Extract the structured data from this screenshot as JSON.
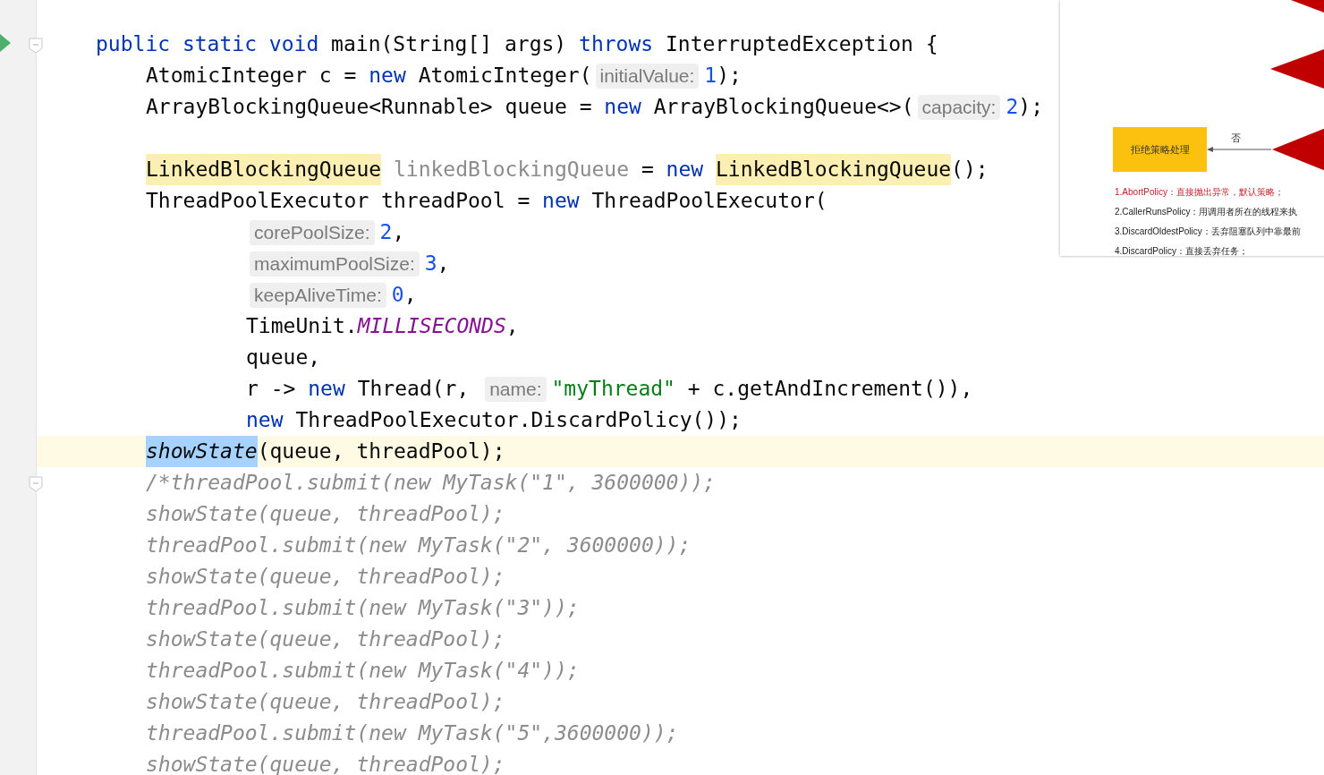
{
  "editor": {
    "lines": [
      {
        "kind": "signature",
        "current": false,
        "tokens": [
          {
            "kind": "kw",
            "text": "public static void "
          },
          {
            "kind": "id",
            "text": "main(String[] args) "
          },
          {
            "kind": "kw",
            "text": "throws "
          },
          {
            "kind": "id",
            "text": "InterruptedException {"
          }
        ]
      },
      {
        "kind": "body",
        "current": false,
        "tokens": [
          {
            "kind": "id",
            "text": "AtomicInteger c = "
          },
          {
            "kind": "kw",
            "text": "new "
          },
          {
            "kind": "id",
            "text": "AtomicInteger("
          },
          {
            "kind": "hint",
            "text": "initialValue:"
          },
          {
            "kind": "num",
            "text": "1"
          },
          {
            "kind": "id",
            "text": ");"
          }
        ]
      },
      {
        "kind": "body",
        "current": false,
        "tokens": [
          {
            "kind": "id",
            "text": "ArrayBlockingQueue<Runnable> queue = "
          },
          {
            "kind": "kw",
            "text": "new "
          },
          {
            "kind": "id",
            "text": "ArrayBlockingQueue<>("
          },
          {
            "kind": "hint",
            "text": "capacity:"
          },
          {
            "kind": "num",
            "text": "2"
          },
          {
            "kind": "id",
            "text": ");"
          }
        ]
      },
      {
        "kind": "blank",
        "current": false
      },
      {
        "kind": "body",
        "current": false,
        "tokens": [
          {
            "kind": "usage",
            "text": "LinkedBlockingQueue"
          },
          {
            "kind": "unused",
            "text": " linkedBlockingQueue"
          },
          {
            "kind": "id",
            "text": " = "
          },
          {
            "kind": "kw",
            "text": "new "
          },
          {
            "kind": "usage",
            "text": "LinkedBlockingQueue"
          },
          {
            "kind": "id",
            "text": "();"
          }
        ]
      },
      {
        "kind": "body",
        "current": false,
        "tokens": [
          {
            "kind": "id",
            "text": "ThreadPoolExecutor threadPool = "
          },
          {
            "kind": "kw",
            "text": "new "
          },
          {
            "kind": "id",
            "text": "ThreadPoolExecutor("
          }
        ]
      },
      {
        "kind": "continuation",
        "current": false,
        "tokens": [
          {
            "kind": "hint",
            "text": "corePoolSize:"
          },
          {
            "kind": "num",
            "text": "2"
          },
          {
            "kind": "id",
            "text": ","
          }
        ]
      },
      {
        "kind": "continuation",
        "current": false,
        "tokens": [
          {
            "kind": "hint",
            "text": "maximumPoolSize:"
          },
          {
            "kind": "num",
            "text": "3"
          },
          {
            "kind": "id",
            "text": ","
          }
        ]
      },
      {
        "kind": "continuation",
        "current": false,
        "tokens": [
          {
            "kind": "hint",
            "text": "keepAliveTime:"
          },
          {
            "kind": "num",
            "text": "0"
          },
          {
            "kind": "id",
            "text": ","
          }
        ]
      },
      {
        "kind": "continuation",
        "current": false,
        "tokens": [
          {
            "kind": "id",
            "text": "TimeUnit."
          },
          {
            "kind": "const",
            "text": "MILLISECONDS"
          },
          {
            "kind": "id",
            "text": ","
          }
        ]
      },
      {
        "kind": "continuation",
        "current": false,
        "tokens": [
          {
            "kind": "id",
            "text": "queue,"
          }
        ]
      },
      {
        "kind": "continuation",
        "current": false,
        "tokens": [
          {
            "kind": "id",
            "text": "r -> "
          },
          {
            "kind": "kw",
            "text": "new "
          },
          {
            "kind": "id",
            "text": "Thread(r, "
          },
          {
            "kind": "hint",
            "text": "name:"
          },
          {
            "kind": "str",
            "text": "\"myThread\""
          },
          {
            "kind": "id",
            "text": " + c.getAndIncrement()),"
          }
        ]
      },
      {
        "kind": "continuation",
        "current": false,
        "tokens": [
          {
            "kind": "kw",
            "text": "new "
          },
          {
            "kind": "id",
            "text": "ThreadPoolExecutor.DiscardPolicy());"
          }
        ]
      },
      {
        "kind": "body",
        "current": true,
        "tokens": [
          {
            "kind": "selected",
            "text": "showState"
          },
          {
            "kind": "id",
            "text": "(queue, threadPool);"
          }
        ]
      },
      {
        "kind": "body",
        "current": false,
        "tokens": [
          {
            "kind": "comment",
            "text": "/*threadPool.submit(new MyTask(\"1\", 3600000));"
          }
        ]
      },
      {
        "kind": "body",
        "current": false,
        "tokens": [
          {
            "kind": "comment",
            "text": "showState(queue, threadPool);"
          }
        ]
      },
      {
        "kind": "body",
        "current": false,
        "tokens": [
          {
            "kind": "comment",
            "text": "threadPool.submit(new MyTask(\"2\", 3600000));"
          }
        ]
      },
      {
        "kind": "body",
        "current": false,
        "tokens": [
          {
            "kind": "comment",
            "text": "showState(queue, threadPool);"
          }
        ]
      },
      {
        "kind": "body",
        "current": false,
        "tokens": [
          {
            "kind": "comment",
            "text": "threadPool.submit(new MyTask(\"3\"));"
          }
        ]
      },
      {
        "kind": "body",
        "current": false,
        "tokens": [
          {
            "kind": "comment",
            "text": "showState(queue, threadPool);"
          }
        ]
      },
      {
        "kind": "body",
        "current": false,
        "tokens": [
          {
            "kind": "comment",
            "text": "threadPool.submit(new MyTask(\"4\"));"
          }
        ]
      },
      {
        "kind": "body",
        "current": false,
        "tokens": [
          {
            "kind": "comment",
            "text": "showState(queue, threadPool);"
          }
        ]
      },
      {
        "kind": "body",
        "current": false,
        "tokens": [
          {
            "kind": "comment",
            "text": "threadPool.submit(new MyTask(\"5\",3600000));"
          }
        ]
      },
      {
        "kind": "body",
        "current": false,
        "tokens": [
          {
            "kind": "comment",
            "text": "showState(queue, threadPool);"
          }
        ]
      }
    ]
  },
  "diagram": {
    "box": "拒绝策略处理",
    "arrow_label": "否",
    "policies": [
      {
        "text": "1.AbortPolicy：直接抛出异常，默认策略；",
        "highlighted": true
      },
      {
        "text": "2.CallerRunsPolicy：用调用者所在的线程来执",
        "highlighted": false
      },
      {
        "text": "3.DiscardOldestPolicy：丢弃阻塞队列中靠最前",
        "highlighted": false
      },
      {
        "text": "4.DiscardPolicy：直接丢弃任务；",
        "highlighted": false
      }
    ]
  }
}
